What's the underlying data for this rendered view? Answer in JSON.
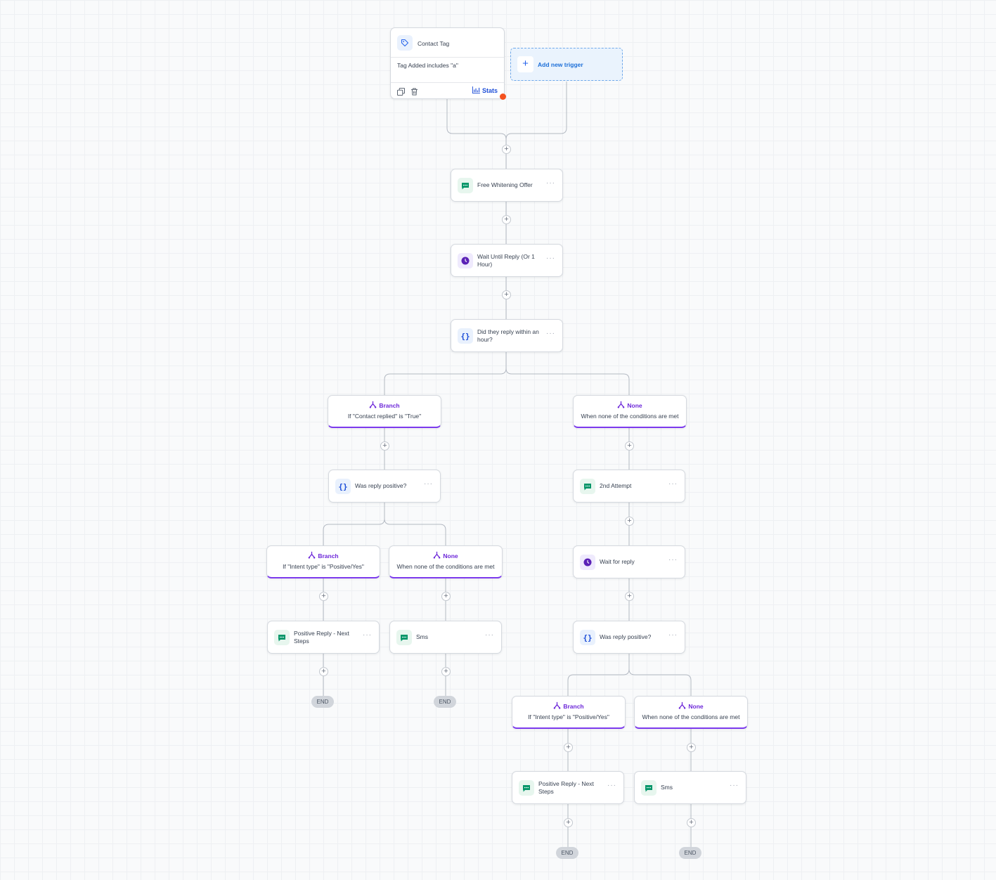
{
  "trigger": {
    "title": "Contact Tag",
    "description": "Tag Added includes \"a\"",
    "stats_label": "Stats",
    "icon": "tag-icon"
  },
  "add_trigger": {
    "label": "Add new trigger",
    "icon": "plus-icon"
  },
  "colors": {
    "accent": "#6d28d9",
    "sms": "#059669",
    "wait": "#5b21b6",
    "condition": "#1d4ed8",
    "link": "#1d6fd8",
    "warning": "#f4511e"
  },
  "nodes": {
    "free_offer": {
      "label": "Free Whitening Offer",
      "icon": "sms-icon"
    },
    "wait_reply": {
      "label": "Wait Until Reply (Or 1 Hour)",
      "icon": "clock-icon"
    },
    "did_reply": {
      "label": "Did they reply within an hour?",
      "icon": "condition-icon"
    },
    "was_positive_1": {
      "label": "Was reply positive?",
      "icon": "condition-icon"
    },
    "positive_reply_1": {
      "label": "Positive Reply - Next Steps",
      "icon": "sms-icon"
    },
    "sms_1": {
      "label": "Sms",
      "icon": "sms-icon"
    },
    "second_attempt": {
      "label": "2nd Attempt",
      "icon": "sms-icon"
    },
    "wait_for_reply": {
      "label": "Wait for reply",
      "icon": "clock-icon"
    },
    "was_positive_2": {
      "label": "Was reply positive?",
      "icon": "condition-icon"
    },
    "positive_reply_2": {
      "label": "Positive Reply - Next Steps",
      "icon": "sms-icon"
    },
    "sms_2": {
      "label": "Sms",
      "icon": "sms-icon"
    }
  },
  "branches": {
    "contact_replied": {
      "title": "Branch",
      "condition": "If \"Contact replied\" is \"True\""
    },
    "none_1": {
      "title": "None",
      "condition": "When none of the conditions are met"
    },
    "intent_1": {
      "title": "Branch",
      "condition": "If \"Intent type\" is \"Positive/Yes\""
    },
    "none_2": {
      "title": "None",
      "condition": "When none of the conditions are met"
    },
    "intent_2": {
      "title": "Branch",
      "condition": "If \"Intent type\" is \"Positive/Yes\""
    },
    "none_3": {
      "title": "None",
      "condition": "When none of the conditions are met"
    }
  },
  "add_step_glyph": "+",
  "end_label": "END"
}
